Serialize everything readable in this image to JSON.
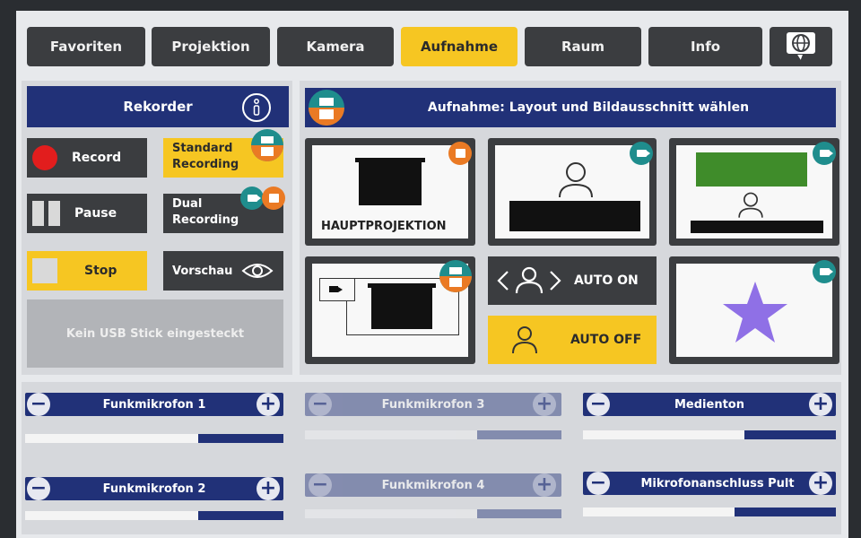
{
  "tabs": [
    {
      "label": "Favoriten",
      "active": false
    },
    {
      "label": "Projektion",
      "active": false
    },
    {
      "label": "Kamera",
      "active": false
    },
    {
      "label": "Aufnahme",
      "active": true
    },
    {
      "label": "Raum",
      "active": false
    },
    {
      "label": "Info",
      "active": false
    }
  ],
  "recorder": {
    "title": "Rekorder",
    "record_label": "Record",
    "standard_recording_label": "Standard Recording",
    "pause_label": "Pause",
    "dual_recording_label": "Dual Recording",
    "stop_label": "Stop",
    "preview_label": "Vorschau",
    "usb_status": "Kein USB Stick eingesteckt"
  },
  "layout": {
    "title": "Aufnahme: Layout und Bildausschnitt wählen",
    "hauptprojektion_label": "HAUPTPROJEKTION",
    "auto_on_label": "AUTO ON",
    "auto_off_label": "AUTO OFF"
  },
  "audio": [
    {
      "label": "Funkmikrofon 1",
      "enabled": true,
      "level": 0.33
    },
    {
      "label": "Funkmikrofon 3",
      "enabled": false,
      "level": 0.33
    },
    {
      "label": "Medienton",
      "enabled": true,
      "level": 0.36
    },
    {
      "label": "Funkmikrofon 2",
      "enabled": true,
      "level": 0.33
    },
    {
      "label": "Funkmikrofon 4",
      "enabled": false,
      "level": 0.33
    },
    {
      "label": "Mikrofonanschluss Pult",
      "enabled": true,
      "level": 0.4
    }
  ],
  "colors": {
    "accent": "#f6c622",
    "navy": "#213178",
    "dark": "#3b3d40",
    "teal": "#1f8d8d",
    "orange": "#ea7a24",
    "record_red": "#e21d1d",
    "star": "#8f70e6",
    "green": "#3f8c2a"
  },
  "icons": [
    "globe-icon",
    "info-icon",
    "record-icon",
    "pause-icon",
    "stop-icon",
    "eye-icon",
    "camera-icon",
    "projector-icon",
    "person-icon",
    "star-icon",
    "minus-icon",
    "plus-icon"
  ]
}
